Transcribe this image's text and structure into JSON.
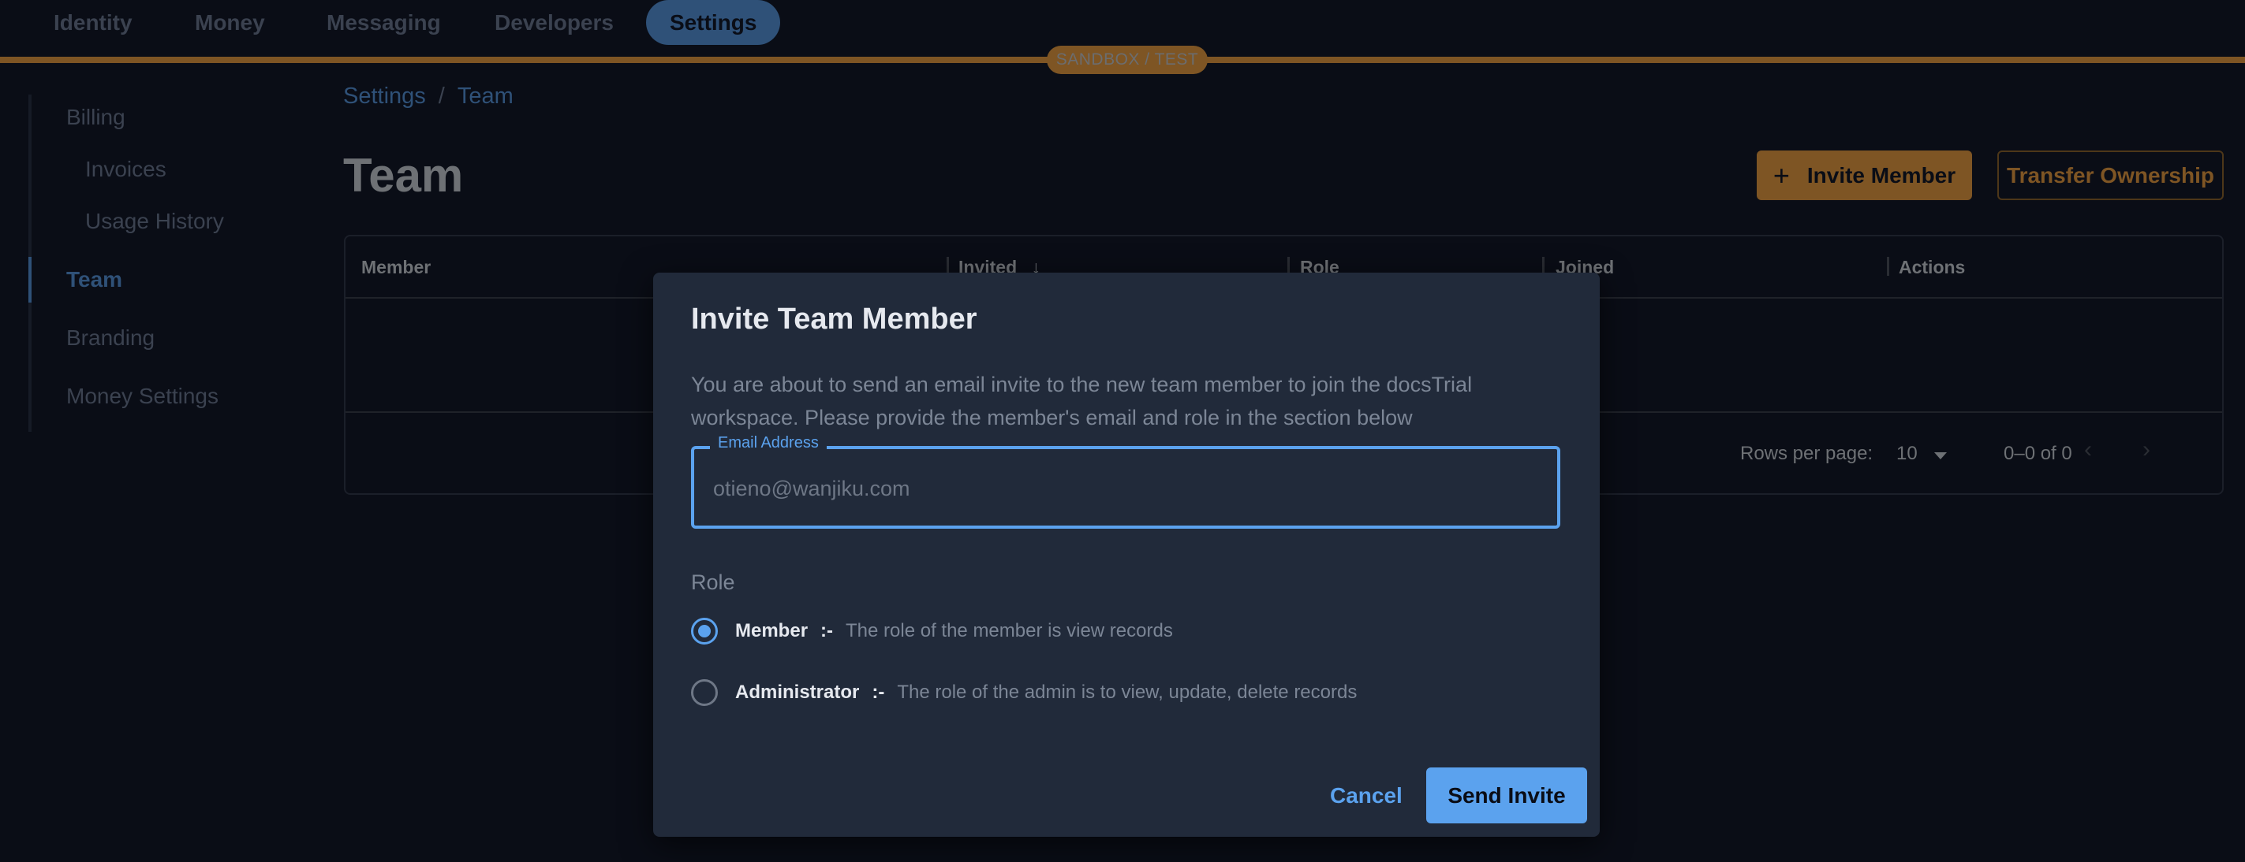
{
  "topnav": {
    "items": [
      {
        "label": "Identity",
        "active": false
      },
      {
        "label": "Money",
        "active": false
      },
      {
        "label": "Messaging",
        "active": false
      },
      {
        "label": "Developers",
        "active": false
      },
      {
        "label": "Settings",
        "active": true
      }
    ],
    "environment_badge": "SANDBOX / TEST"
  },
  "sidebar": {
    "items": [
      {
        "label": "Billing",
        "level": 0,
        "active": false
      },
      {
        "label": "Invoices",
        "level": 1,
        "active": false
      },
      {
        "label": "Usage History",
        "level": 1,
        "active": false
      },
      {
        "label": "Team",
        "level": 0,
        "active": true
      },
      {
        "label": "Branding",
        "level": 0,
        "active": false
      },
      {
        "label": "Money Settings",
        "level": 0,
        "active": false
      }
    ]
  },
  "breadcrumb": {
    "items": [
      "Settings",
      "Team"
    ],
    "separator": "/"
  },
  "page": {
    "title": "Team",
    "invite_button": "Invite Member",
    "invite_icon": "plus-icon",
    "transfer_button": "Transfer Ownership"
  },
  "table": {
    "columns": [
      {
        "label": "Member",
        "sorted": null
      },
      {
        "label": "Invited",
        "sorted": "desc"
      },
      {
        "label": "Role",
        "sorted": null
      },
      {
        "label": "Joined",
        "sorted": null
      },
      {
        "label": "Actions",
        "sorted": null
      }
    ],
    "rows": [],
    "pagination": {
      "rows_per_page_label": "Rows per page:",
      "rows_per_page": "10",
      "range": "0–0 of 0"
    }
  },
  "dialog": {
    "title": "Invite Team Member",
    "description": "You are about to send an email invite to the new team member to join the docsTrial workspace. Please provide the member's email and role in the section below",
    "email": {
      "label": "Email Address",
      "value": "",
      "placeholder": "otieno@wanjiku.com"
    },
    "role_label": "Role",
    "roles": [
      {
        "name": "Member",
        "separator": ":-",
        "description": "The role of the member is view records",
        "checked": true
      },
      {
        "name": "Administrator",
        "separator": ":-",
        "description": "The role of the admin is to view, update, delete records",
        "checked": false
      }
    ],
    "cancel_button": "Cancel",
    "send_button": "Send Invite"
  },
  "colors": {
    "background": "#0a0d16",
    "dialog_bg": "#212a3a",
    "primary_blue": "#5ba2ee",
    "accent_gold": "#7e5524",
    "nav_active": "#2f5178"
  }
}
